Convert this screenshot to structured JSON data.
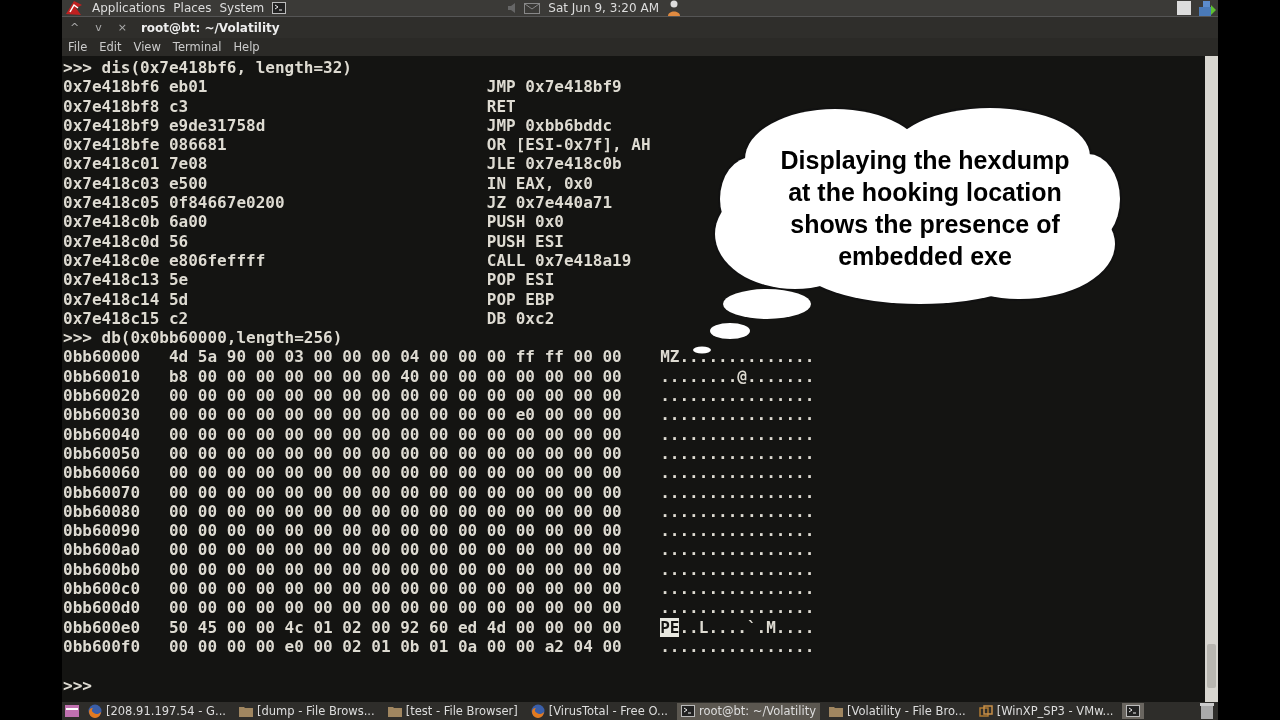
{
  "top_panel": {
    "menus": [
      "Applications",
      "Places",
      "System"
    ],
    "clock": "Sat Jun  9,  3:20 AM"
  },
  "window": {
    "buttons": [
      "^",
      "v",
      "×"
    ],
    "title": "root@bt: ~/Volatility"
  },
  "menubar": [
    "File",
    "Edit",
    "View",
    "Terminal",
    "Help"
  ],
  "terminal": {
    "lines": [
      {
        "kind": "prompt",
        "text": ">>> dis(0x7e418bf6, length=32)"
      },
      {
        "kind": "disasm",
        "address": "0x7e418bf6",
        "bytes": "eb01",
        "instruction": "JMP 0x7e418bf9"
      },
      {
        "kind": "disasm",
        "address": "0x7e418bf8",
        "bytes": "c3",
        "instruction": "RET"
      },
      {
        "kind": "disasm",
        "address": "0x7e418bf9",
        "bytes": "e9de31758d",
        "instruction": "JMP 0xbb6bddc"
      },
      {
        "kind": "disasm",
        "address": "0x7e418bfe",
        "bytes": "086681",
        "instruction": "OR [ESI-0x7f], AH"
      },
      {
        "kind": "disasm",
        "address": "0x7e418c01",
        "bytes": "7e08",
        "instruction": "JLE 0x7e418c0b"
      },
      {
        "kind": "disasm",
        "address": "0x7e418c03",
        "bytes": "e500",
        "instruction": "IN EAX, 0x0"
      },
      {
        "kind": "disasm",
        "address": "0x7e418c05",
        "bytes": "0f84667e0200",
        "instruction": "JZ 0x7e440a71"
      },
      {
        "kind": "disasm",
        "address": "0x7e418c0b",
        "bytes": "6a00",
        "instruction": "PUSH 0x0"
      },
      {
        "kind": "disasm",
        "address": "0x7e418c0d",
        "bytes": "56",
        "instruction": "PUSH ESI"
      },
      {
        "kind": "disasm",
        "address": "0x7e418c0e",
        "bytes": "e806feffff",
        "instruction": "CALL 0x7e418a19"
      },
      {
        "kind": "disasm",
        "address": "0x7e418c13",
        "bytes": "5e",
        "instruction": "POP ESI"
      },
      {
        "kind": "disasm",
        "address": "0x7e418c14",
        "bytes": "5d",
        "instruction": "POP EBP"
      },
      {
        "kind": "disasm",
        "address": "0x7e418c15",
        "bytes": "c2",
        "instruction": "DB 0xc2"
      },
      {
        "kind": "prompt",
        "text": ">>> db(0x0bb60000,length=256)"
      },
      {
        "kind": "hex",
        "offset": "0bb60000",
        "bytes": "4d 5a 90 00 03 00 00 00 04 00 00 00 ff ff 00 00",
        "ascii": "MZ.............."
      },
      {
        "kind": "hex",
        "offset": "0bb60010",
        "bytes": "b8 00 00 00 00 00 00 00 40 00 00 00 00 00 00 00",
        "ascii": "........@......."
      },
      {
        "kind": "hex",
        "offset": "0bb60020",
        "bytes": "00 00 00 00 00 00 00 00 00 00 00 00 00 00 00 00",
        "ascii": "................"
      },
      {
        "kind": "hex",
        "offset": "0bb60030",
        "bytes": "00 00 00 00 00 00 00 00 00 00 00 00 e0 00 00 00",
        "ascii": "................"
      },
      {
        "kind": "hex",
        "offset": "0bb60040",
        "bytes": "00 00 00 00 00 00 00 00 00 00 00 00 00 00 00 00",
        "ascii": "................"
      },
      {
        "kind": "hex",
        "offset": "0bb60050",
        "bytes": "00 00 00 00 00 00 00 00 00 00 00 00 00 00 00 00",
        "ascii": "................"
      },
      {
        "kind": "hex",
        "offset": "0bb60060",
        "bytes": "00 00 00 00 00 00 00 00 00 00 00 00 00 00 00 00",
        "ascii": "................"
      },
      {
        "kind": "hex",
        "offset": "0bb60070",
        "bytes": "00 00 00 00 00 00 00 00 00 00 00 00 00 00 00 00",
        "ascii": "................"
      },
      {
        "kind": "hex",
        "offset": "0bb60080",
        "bytes": "00 00 00 00 00 00 00 00 00 00 00 00 00 00 00 00",
        "ascii": "................"
      },
      {
        "kind": "hex",
        "offset": "0bb60090",
        "bytes": "00 00 00 00 00 00 00 00 00 00 00 00 00 00 00 00",
        "ascii": "................"
      },
      {
        "kind": "hex",
        "offset": "0bb600a0",
        "bytes": "00 00 00 00 00 00 00 00 00 00 00 00 00 00 00 00",
        "ascii": "................"
      },
      {
        "kind": "hex",
        "offset": "0bb600b0",
        "bytes": "00 00 00 00 00 00 00 00 00 00 00 00 00 00 00 00",
        "ascii": "................"
      },
      {
        "kind": "hex",
        "offset": "0bb600c0",
        "bytes": "00 00 00 00 00 00 00 00 00 00 00 00 00 00 00 00",
        "ascii": "................"
      },
      {
        "kind": "hex",
        "offset": "0bb600d0",
        "bytes": "00 00 00 00 00 00 00 00 00 00 00 00 00 00 00 00",
        "ascii": "................"
      },
      {
        "kind": "hex",
        "offset": "0bb600e0",
        "bytes": "50 45 00 00 4c 01 02 00 92 60 ed 4d 00 00 00 00",
        "marked": "PE",
        "ascii": "..L....`.M...."
      },
      {
        "kind": "hex",
        "offset": "0bb600f0",
        "bytes": "00 00 00 00 e0 00 02 01 0b 01 0a 00 00 a2 04 00",
        "ascii": "................"
      }
    ],
    "final_prompt": ">>>"
  },
  "callout": "Displaying the hexdump at the hooking location shows the presence of embedded exe",
  "taskbar": [
    {
      "kind": "browser",
      "label": "[208.91.197.54 - G...",
      "selected": false
    },
    {
      "kind": "folder",
      "label": "[dump - File Brows...",
      "selected": false
    },
    {
      "kind": "folder",
      "label": "[test - File Browser]",
      "selected": false
    },
    {
      "kind": "browser",
      "label": "[VirusTotal - Free O...",
      "selected": false
    },
    {
      "kind": "terminal",
      "label": "root@bt: ~/Volatility",
      "selected": true
    },
    {
      "kind": "folder",
      "label": "[Volatility - File Bro...",
      "selected": false
    },
    {
      "kind": "vm",
      "label": "[WinXP_SP3 - VMw...",
      "selected": false
    }
  ]
}
